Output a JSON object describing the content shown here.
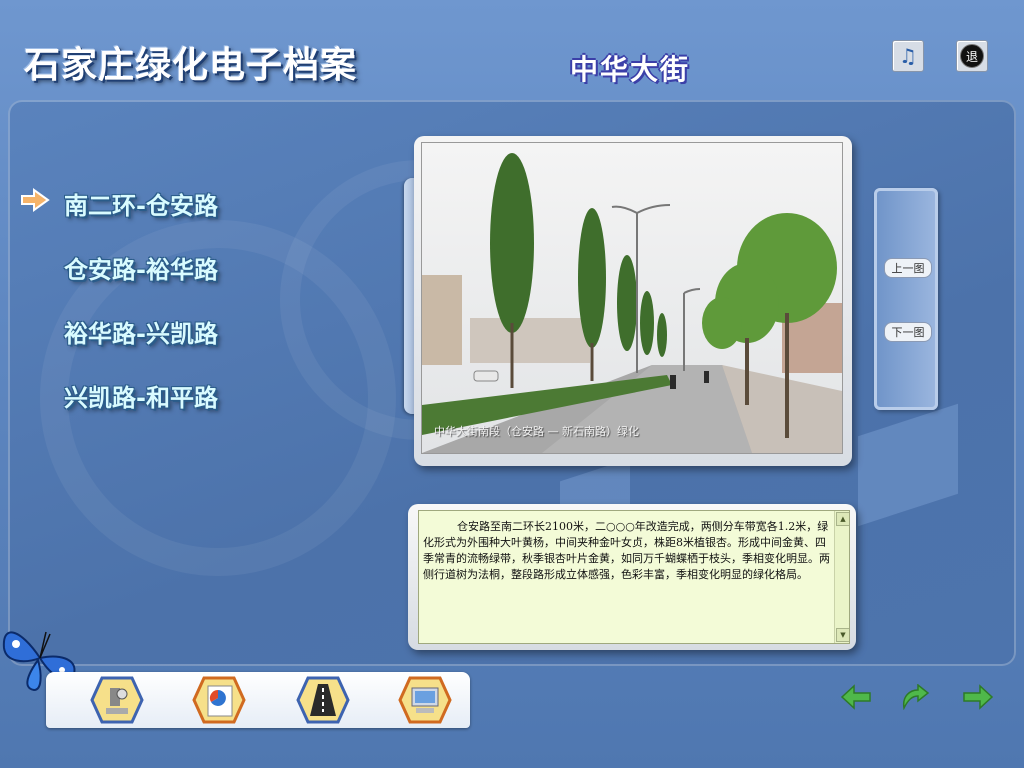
{
  "app": {
    "title": "石家庄绿化电子档案",
    "street_name": "中华大街"
  },
  "top_buttons": {
    "music_icon": "music-note-icon",
    "exit_label": "退"
  },
  "menu": {
    "items": [
      {
        "label": "南二环-仓安路",
        "selected": true
      },
      {
        "label": "仓安路-裕华路",
        "selected": false
      },
      {
        "label": "裕华路-兴凯路",
        "selected": false
      },
      {
        "label": "兴凯路-和平路",
        "selected": false
      }
    ]
  },
  "photo": {
    "caption": "中华大街南段（仓安路 — 新石南路）绿化"
  },
  "side_nav": {
    "prev_label": "上一图",
    "next_label": "下一图"
  },
  "description": {
    "text": "仓安路至南二环长2100米，二○○○年改造完成，两侧分车带宽各1.2米，绿化形式为外围种大叶黄杨，中间夹种金叶女贞，株距8米植银杏。形成中间金黄、四季常青的流畅绿带，秋季银杏叶片金黄，如同万千蝴蝶栖于枝头，季相变化明显。两侧行道树为法桐，整段路形成立体感强，色彩丰富，季相变化明显的绿化格局。"
  },
  "dock": {
    "icons": [
      "microscope-icon",
      "pie-chart-document-icon",
      "road-icon",
      "computer-monitor-icon"
    ]
  },
  "bottom_nav": {
    "icons": [
      "back-arrow-icon",
      "return-arrow-icon",
      "forward-arrow-icon"
    ]
  },
  "colors": {
    "background": "#5b7fb4",
    "menu_text": "#d9fbff",
    "desc_bg": "#f3fbd7",
    "arrow_green": "#4fb84a"
  }
}
